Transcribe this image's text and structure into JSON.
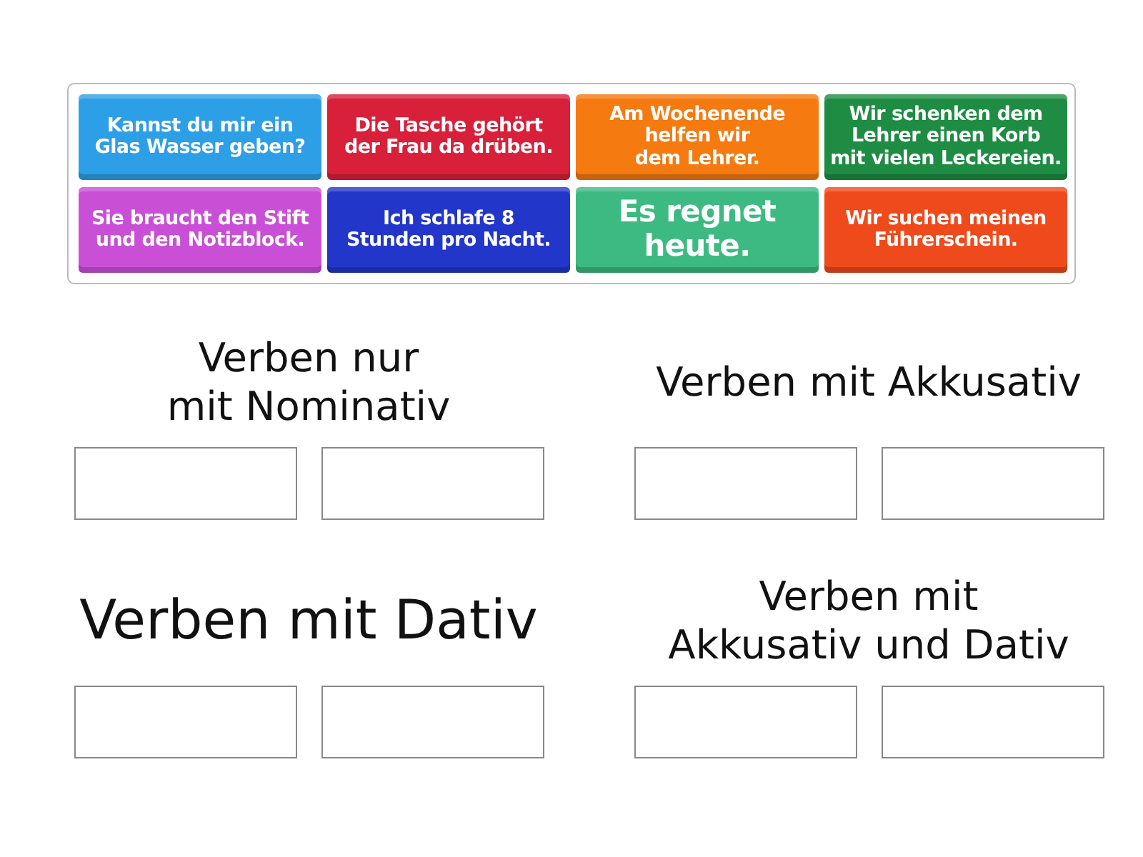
{
  "cards": [
    {
      "lines": [
        "Kannst du mir ein",
        "Glas Wasser geben?"
      ],
      "color": "#2d9fe6"
    },
    {
      "lines": [
        "Die Tasche gehört",
        "der Frau da drüben."
      ],
      "color": "#d8203a"
    },
    {
      "lines": [
        "Am Wochenende",
        "helfen wir",
        "dem Lehrer."
      ],
      "color": "#f57a10"
    },
    {
      "lines": [
        "Wir schenken dem",
        "Lehrer einen Korb",
        "mit vielen Leckereien."
      ],
      "color": "#1e8c43"
    },
    {
      "lines": [
        "Sie braucht den Stift",
        "und den Notizblock."
      ],
      "color": "#c94fd6"
    },
    {
      "lines": [
        "Ich schlafe 8",
        "Stunden pro Nacht."
      ],
      "color": "#2237c9"
    },
    {
      "lines": [
        "Es regnet",
        "heute."
      ],
      "color": "#3dba82"
    },
    {
      "lines": [
        "Wir suchen meinen",
        "Führerschein."
      ],
      "color": "#ef4a1c"
    }
  ],
  "groups": [
    {
      "title_lines": [
        "Verben nur",
        "mit Nominativ"
      ]
    },
    {
      "title_lines": [
        "Verben mit Akkusativ"
      ]
    },
    {
      "title_lines": [
        "Verben mit Dativ"
      ]
    },
    {
      "title_lines": [
        "Verben mit",
        "Akkusativ und Dativ"
      ]
    }
  ]
}
